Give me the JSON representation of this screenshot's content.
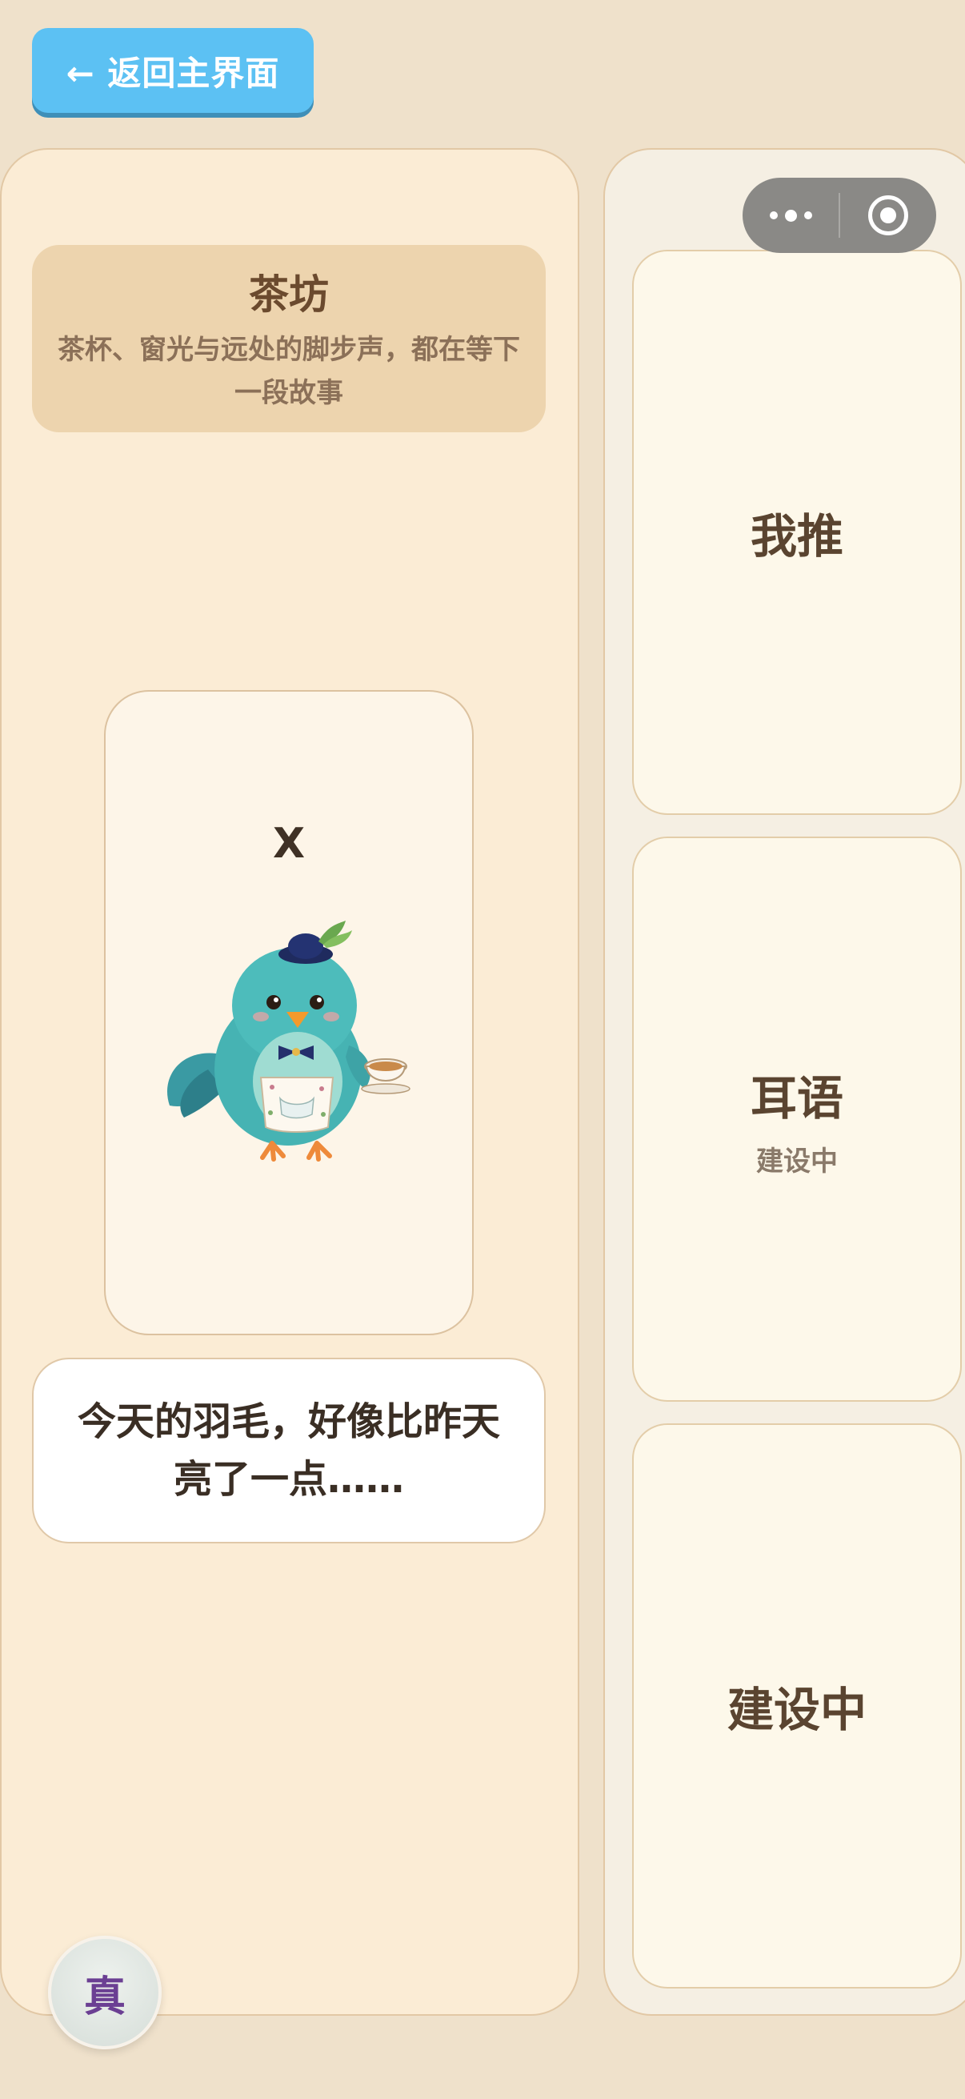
{
  "nav": {
    "back_label": "← 返回主界面"
  },
  "tea_shop": {
    "title": "茶坊",
    "subtitle_line1": "茶杯、窗光与远处的脚步声，都在等下",
    "subtitle_line2": "一段故事"
  },
  "character": {
    "name": "X",
    "speech_line1": "今天的羽毛，好像比昨天",
    "speech_line2": "亮了一点……"
  },
  "side_menu": [
    {
      "label": "我推",
      "sublabel": ""
    },
    {
      "label": "耳语",
      "sublabel": "建设中"
    },
    {
      "label": "建设中",
      "sublabel": ""
    }
  ],
  "truth_button": {
    "label": "真"
  },
  "colors": {
    "accent_blue": "#5cc1f3",
    "background": "#efe1cb",
    "panel": "#fbecd5",
    "title_brown": "#6b4a2e",
    "truth_purple": "#6b3f93"
  }
}
